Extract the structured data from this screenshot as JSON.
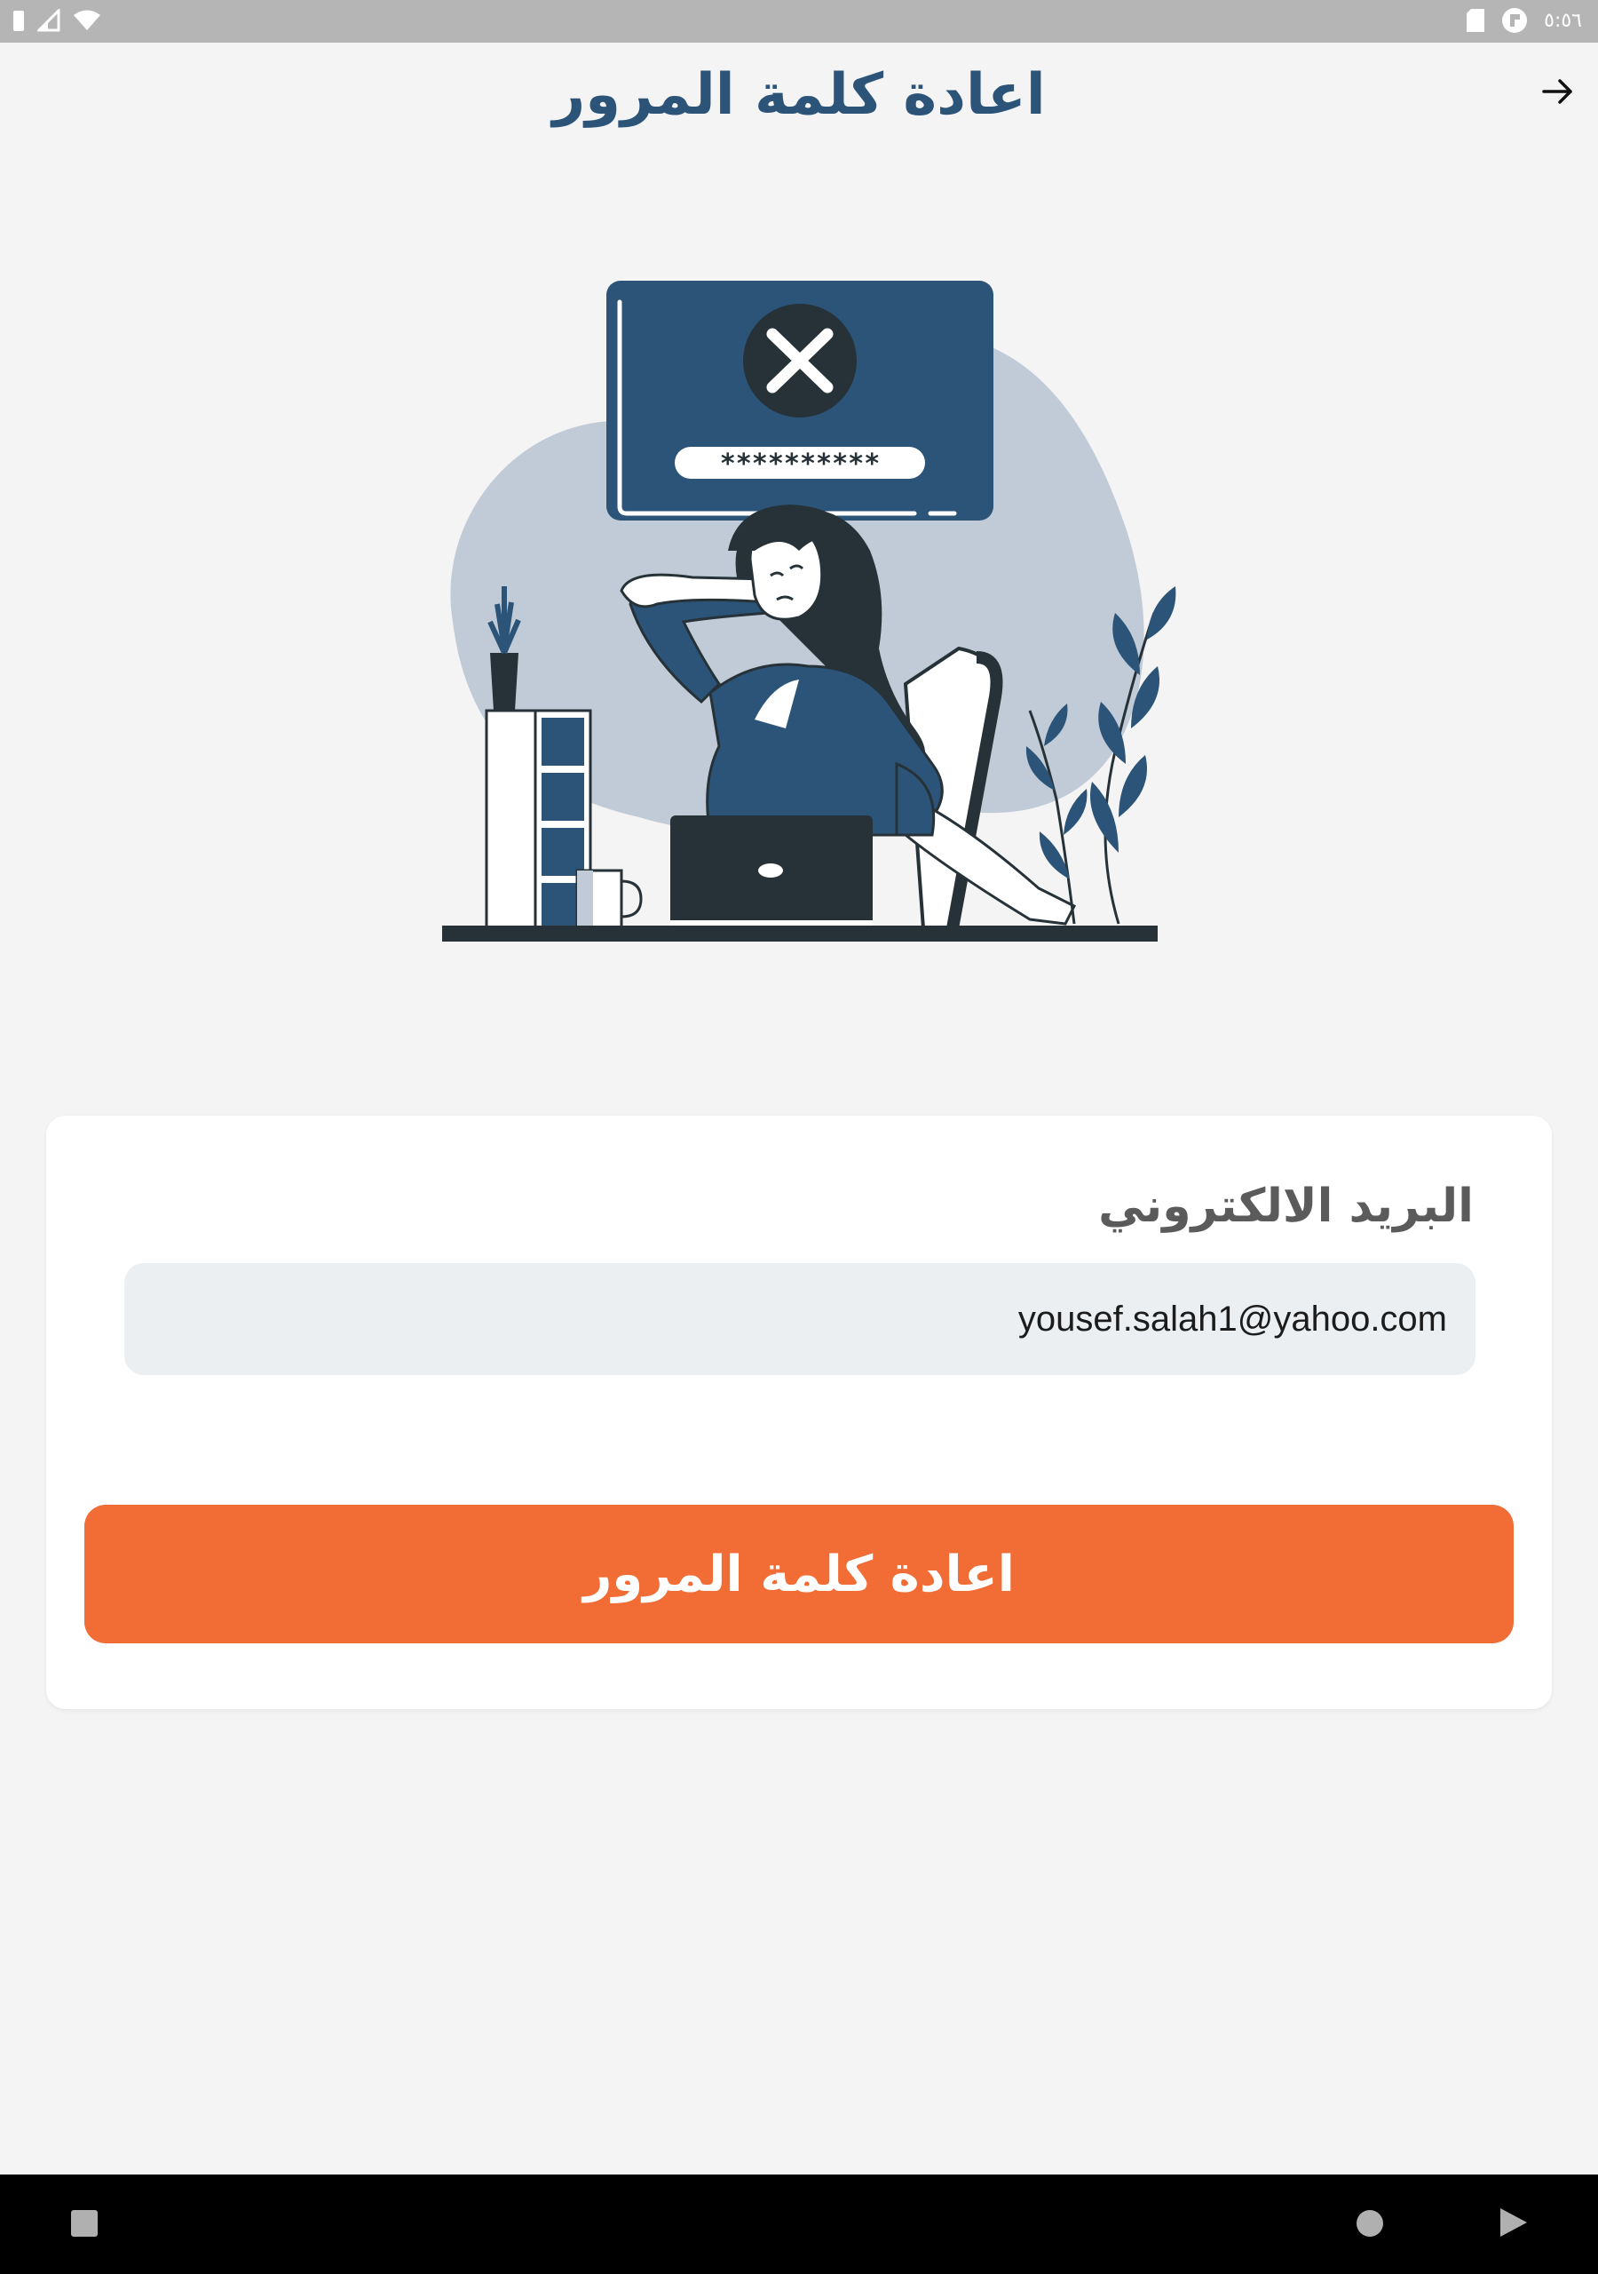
{
  "status_bar": {
    "time": "٥:٥٦"
  },
  "header": {
    "title": "اعادة كلمة المرور"
  },
  "illustration": {
    "password_mask": "**********"
  },
  "form": {
    "email_label": "البريد الالكتروني",
    "email_value": "yousef.salah1@yahoo.com"
  },
  "actions": {
    "reset_label": "اعادة كلمة المرور"
  },
  "colors": {
    "title": "#2c5478",
    "button": "#f26d35",
    "input_bg": "#ebeff2",
    "illustration_navy": "#2c5478"
  }
}
